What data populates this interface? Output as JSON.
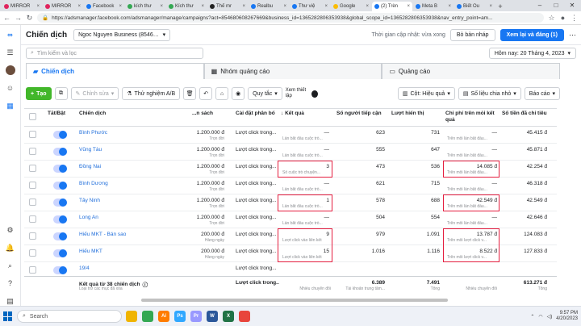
{
  "browser": {
    "tabs": [
      {
        "label": "MIRROR",
        "color": "#e0245e"
      },
      {
        "label": "MIRROR",
        "color": "#e0245e"
      },
      {
        "label": "Facebook",
        "color": "#1877f2"
      },
      {
        "label": "kích thư",
        "color": "#34a853"
      },
      {
        "label": "Kích thư",
        "color": "#34a853"
      },
      {
        "label": "Thế mr",
        "color": "#222222"
      },
      {
        "label": "Realbu",
        "color": "#1877f2"
      },
      {
        "label": "Thư việ",
        "color": "#1877f2"
      },
      {
        "label": "Google",
        "color": "#fbbc05"
      },
      {
        "label": "(2) Trèn",
        "color": "#1877f2"
      },
      {
        "label": "Meta B",
        "color": "#1877f2"
      },
      {
        "label": "Biết Ou",
        "color": "#1877f2"
      }
    ],
    "url": "https://adsmanager.facebook.com/adsmanager/manage/campaigns?act=854680608267669&business_id=1365282806353938&global_scope_id=1365282806353938&nav_entry_point=am..."
  },
  "header": {
    "title": "Chiến dịch",
    "account": "Ngoc Nguyen Business (854680608267669)",
    "updated": "Thời gian cập nhật: vừa xong",
    "discard_label": "Bỏ bản nháp",
    "review_label": "Xem lại và đăng (1)"
  },
  "search": {
    "placeholder": "Tìm kiếm và lọc",
    "date_range": "Hôm nay: 20 Tháng 4, 2023"
  },
  "levels": {
    "campaigns": "Chiến dịch",
    "adsets": "Nhóm quảng cáo",
    "ads": "Quảng cáo"
  },
  "toolbar": {
    "create": "Tạo",
    "edit": "Chỉnh sửa",
    "ab_test": "Thử nghiệm A/B",
    "rules": "Quy tắc",
    "view_setup": "Xem thiết lập",
    "columns": "Cột: Hiệu quả",
    "breakdown": "Số liệu chia nhỏ",
    "reports": "Báo cáo"
  },
  "columns": {
    "toggle": "Tắt/Bật",
    "name": "Chiến dịch",
    "budget": "...n sách",
    "attribution": "Cài đặt phân bổ",
    "results": "Kết quả",
    "reach": "Số người tiếp cận",
    "impressions": "Lượt hiển thị",
    "cost_per_result": "Chi phí trên mỗi kết quả",
    "amount_spent": "Số tiền đã chi tiêu"
  },
  "rows": [
    {
      "name": "Bình Phước",
      "budget": "1.200.000 đ",
      "budget_sub": "Trọn đời",
      "attribution": "Lượt click trong...",
      "results": "—",
      "results_sub": "Lần bắt đầu cuộc trò...",
      "reach": "623",
      "impressions": "731",
      "cpr": "—",
      "cpr_sub": "Trên mỗi lần bắt đầu...",
      "spent": "45.415 đ"
    },
    {
      "name": "Vũng Tàu",
      "budget": "1.200.000 đ",
      "budget_sub": "Trọn đời",
      "attribution": "Lượt click trong...",
      "results": "—",
      "results_sub": "Lần bắt đầu cuộc trò...",
      "reach": "555",
      "impressions": "647",
      "cpr": "—",
      "cpr_sub": "Trên mỗi lần bắt đầu...",
      "spent": "45.871 đ"
    },
    {
      "name": "Đồng Nai",
      "budget": "1.200.000 đ",
      "budget_sub": "Trọn đời",
      "attribution": "Lượt click trong...",
      "results": "3",
      "results_sub": "Số cuộc trò chuyện...",
      "reach": "473",
      "impressions": "536",
      "cpr": "14.085 đ",
      "cpr_sub": "Trên mỗi lần bắt đầu...",
      "spent": "42.254 đ"
    },
    {
      "name": "Bình Dương",
      "budget": "1.200.000 đ",
      "budget_sub": "Trọn đời",
      "attribution": "Lượt click trong...",
      "results": "—",
      "results_sub": "Lần bắt đầu cuộc trò...",
      "reach": "621",
      "impressions": "715",
      "cpr": "—",
      "cpr_sub": "Trên mỗi lần bắt đầu...",
      "spent": "46.318 đ"
    },
    {
      "name": "Tây Ninh",
      "budget": "1.200.000 đ",
      "budget_sub": "Trọn đời",
      "attribution": "Lượt click trong...",
      "results": "1",
      "results_sub": "Lần bắt đầu cuộc trò...",
      "reach": "578",
      "impressions": "688",
      "cpr": "42.549 đ",
      "cpr_sub": "Trên mỗi lần bắt đầu...",
      "spent": "42.549 đ"
    },
    {
      "name": "Long An",
      "budget": "1.200.000 đ",
      "budget_sub": "Trọn đời",
      "attribution": "Lượt click trong...",
      "results": "—",
      "results_sub": "Lần bắt đầu cuộc trò...",
      "reach": "504",
      "impressions": "554",
      "cpr": "—",
      "cpr_sub": "Trên mỗi lần bắt đầu...",
      "spent": "42.646 đ"
    },
    {
      "name": "Hiếu MKT - Bán sao",
      "budget": "200.000 đ",
      "budget_sub": "Hàng ngày",
      "attribution": "Lượt click trong...",
      "results": "9",
      "results_sub": "Lượt click vào liên kết",
      "reach": "979",
      "impressions": "1.091",
      "cpr": "13.787 đ",
      "cpr_sub": "Trên mỗi lượt click v...",
      "spent": "124.083 đ"
    },
    {
      "name": "Hiếu MKT",
      "budget": "200.000 đ",
      "budget_sub": "Hàng ngày",
      "attribution": "Lượt click trong...",
      "results": "15",
      "results_sub": "Lượt click vào liên kết",
      "reach": "1.016",
      "impressions": "1.116",
      "cpr": "8.522 đ",
      "cpr_sub": "Trên mỗi lượt click v...",
      "spent": "127.833 đ"
    },
    {
      "name": "19/4",
      "budget": "",
      "budget_sub": "",
      "attribution": "Lượt click trong...",
      "results": "",
      "results_sub": "",
      "reach": "",
      "impressions": "",
      "cpr": "",
      "cpr_sub": "",
      "spent": ""
    }
  ],
  "footer": {
    "label": "Kết quả từ 38 chiến dịch",
    "sub": "Loại trừ các mục đã xóa",
    "attribution": "Lượt click trong...",
    "results_sub": "Nhiều chuyển đổi",
    "reach": "6.389",
    "reach_sub": "Tài khoản trung tâm...",
    "impressions": "7.491",
    "impressions_sub": "Tổng",
    "cpr_sub": "Nhiều chuyển đổi",
    "spent": "613.271 đ",
    "spent_sub": "Tổng"
  },
  "taskbar": {
    "search": "Search",
    "time": "9:57 PM",
    "date": "4/20/2023",
    "apps": [
      {
        "icon": "file-explorer-icon",
        "label": "",
        "color": "#f0b400"
      },
      {
        "icon": "chrome-icon",
        "label": "",
        "color": "#34a853"
      },
      {
        "icon": "illustrator-icon",
        "label": "Ai",
        "color": "#ff7c00"
      },
      {
        "icon": "photoshop-icon",
        "label": "Ps",
        "color": "#31a8ff"
      },
      {
        "icon": "premiere-icon",
        "label": "Pr",
        "color": "#9999ff"
      },
      {
        "icon": "word-icon",
        "label": "W",
        "color": "#2b579a"
      },
      {
        "icon": "excel-icon",
        "label": "X",
        "color": "#217346"
      },
      {
        "icon": "media-icon",
        "label": "",
        "color": "#e8453c"
      }
    ]
  }
}
